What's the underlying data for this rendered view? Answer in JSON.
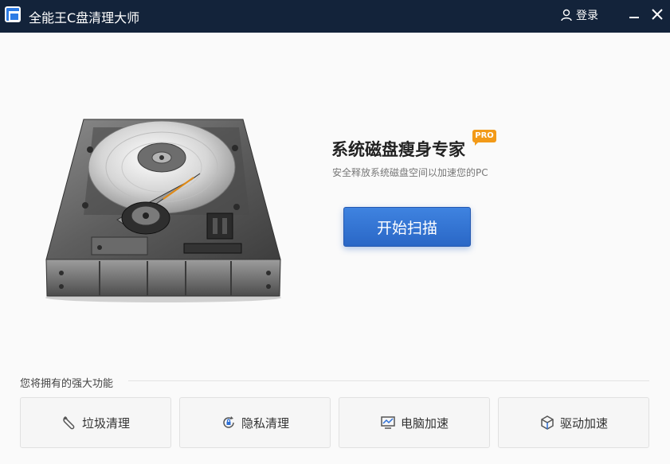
{
  "window": {
    "title": "全能王C盘清理大师",
    "login_label": "登录"
  },
  "hero": {
    "product_name": "系统磁盘瘦身专家",
    "badge": "PRO",
    "subtitle": "安全释放系统磁盘空间以加速您的PC",
    "scan_button": "开始扫描"
  },
  "features": {
    "heading": "您将拥有的强大功能",
    "items": [
      {
        "label": "垃圾清理",
        "icon": "wrench-icon"
      },
      {
        "label": "隐私清理",
        "icon": "refresh-lock-icon"
      },
      {
        "label": "电脑加速",
        "icon": "monitor-chart-icon"
      },
      {
        "label": "驱动加速",
        "icon": "cube-icon"
      }
    ]
  },
  "colors": {
    "titlebar": "#13233a",
    "accent": "#2c6fd6",
    "badge": "#f29a18"
  }
}
